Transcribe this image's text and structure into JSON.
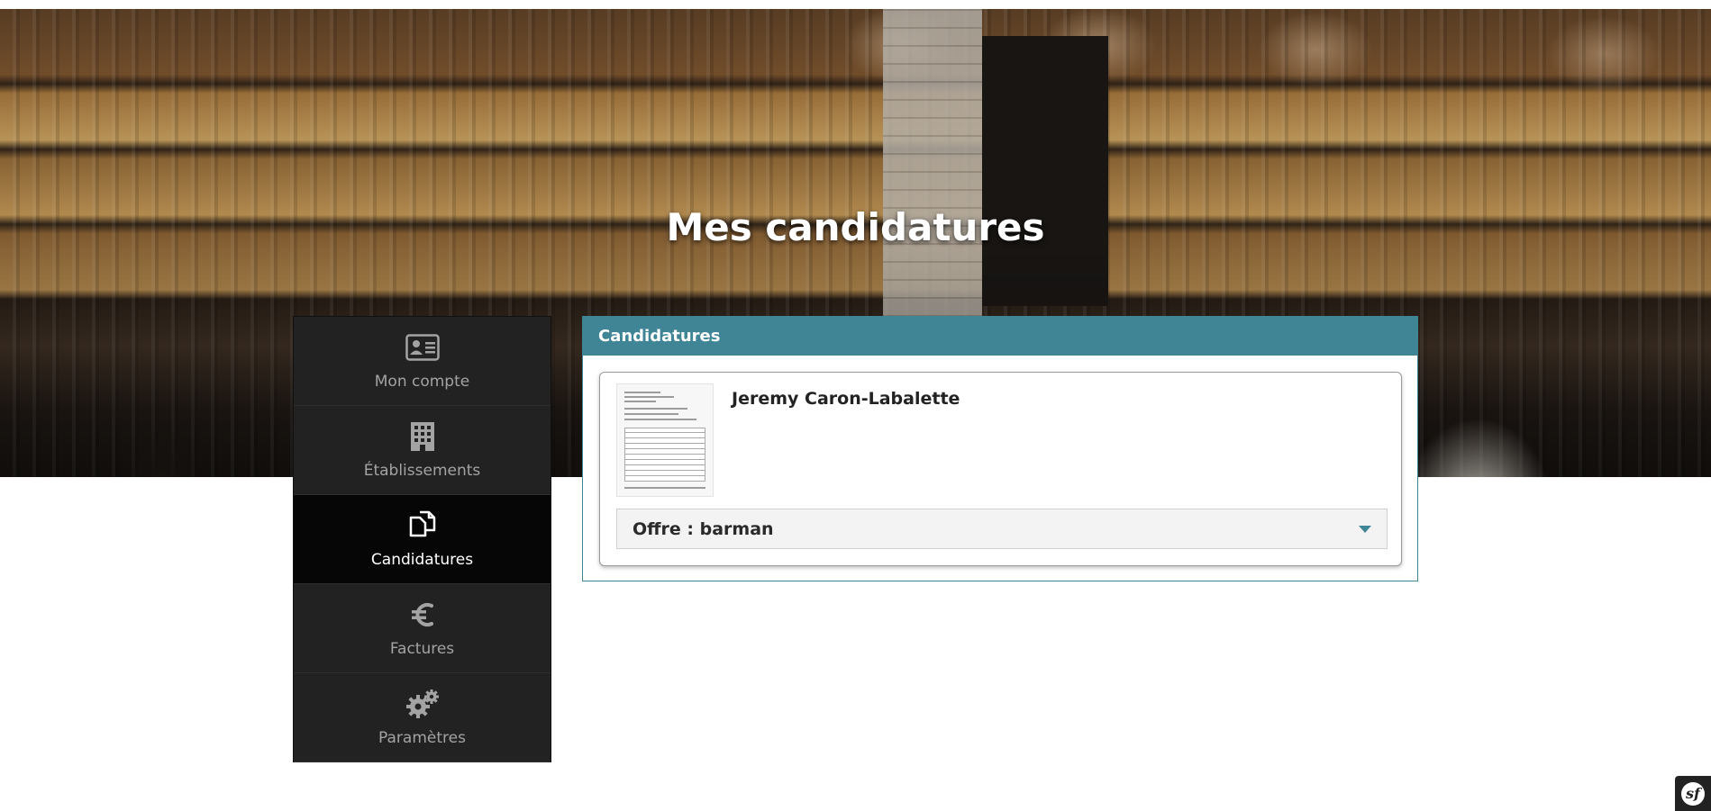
{
  "header": {
    "title": "Mes candidatures"
  },
  "sidebar": {
    "items": [
      {
        "label": "Mon compte",
        "icon": "id-card-icon",
        "active": false
      },
      {
        "label": "Établissements",
        "icon": "building-icon",
        "active": false
      },
      {
        "label": "Candidatures",
        "icon": "documents-icon",
        "active": true
      },
      {
        "label": "Factures",
        "icon": "euro-icon",
        "active": false
      },
      {
        "label": "Paramètres",
        "icon": "gears-icon",
        "active": false
      }
    ]
  },
  "panel": {
    "title": "Candidatures",
    "applications": [
      {
        "name": "Jeremy Caron-Labalette",
        "offer": "Offre : barman"
      }
    ]
  },
  "toolbar": {
    "symfony_glyph": "sf"
  },
  "colors": {
    "accent": "#3f8596",
    "sidebar_bg": "#222222",
    "sidebar_active": "#060606"
  }
}
